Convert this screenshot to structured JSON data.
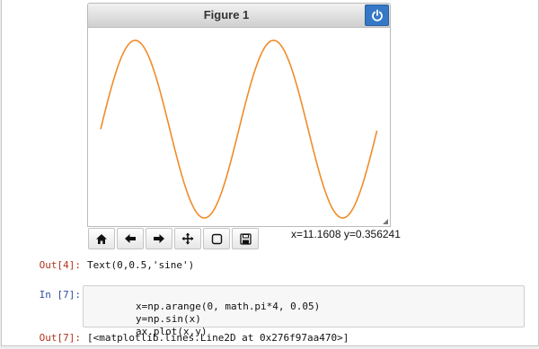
{
  "figure": {
    "title": "Figure 1",
    "coords_readout": "x=11.1608 y=0.356241",
    "line_color": "#f08c2a",
    "toolbar": {
      "buttons": [
        {
          "icon": "home-icon",
          "action": "home"
        },
        {
          "icon": "back-arrow-icon",
          "action": "back"
        },
        {
          "icon": "forward-arrow-icon",
          "action": "forward"
        },
        {
          "icon": "pan-move-icon",
          "action": "pan"
        },
        {
          "icon": "zoom-rect-icon",
          "action": "zoom"
        },
        {
          "icon": "save-disk-icon",
          "action": "save"
        }
      ]
    }
  },
  "cells": {
    "out4": {
      "prompt": "Out[4]:",
      "text": "Text(0,0.5,'sine')"
    },
    "in7": {
      "prompt": "In [7]:",
      "lines": [
        "x=np.arange(0, math.pi*4, 0.05)",
        "y=np.sin(x)",
        "ax.plot(x,y)"
      ]
    },
    "out7": {
      "prompt": "Out[7]:",
      "text": "[<matplotlib.lines.Line2D at 0x276f97aa470>]"
    }
  },
  "chart_data": {
    "type": "line",
    "series": [
      {
        "x_start": 0,
        "x_end": 12.566,
        "x_step": 0.05,
        "function": "sin(x)"
      }
    ],
    "ylim": [
      -1,
      1
    ],
    "xlim": [
      0,
      12.566
    ],
    "grid": false,
    "axes_visible": false
  }
}
